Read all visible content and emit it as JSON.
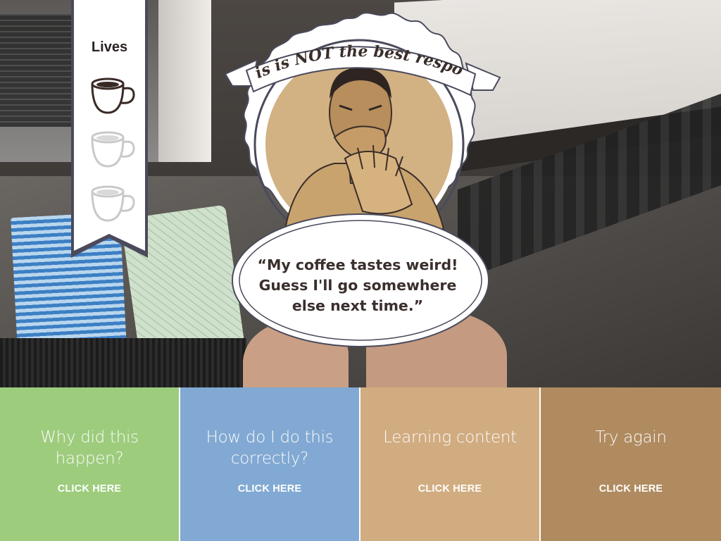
{
  "lives": {
    "title": "Lives",
    "total": 3,
    "remaining": 1,
    "cups": [
      {
        "state": "full",
        "icon": "coffee-cup-full-icon"
      },
      {
        "state": "empty",
        "icon": "coffee-cup-empty-icon"
      },
      {
        "state": "empty",
        "icon": "coffee-cup-empty-icon"
      }
    ]
  },
  "feedback": {
    "ribbon_text": "This is NOT the best response",
    "quote": "“My coffee tastes weird! Guess I'll go somewhere else next time.”",
    "illustration": "disgusted-customer-illustration"
  },
  "actions": [
    {
      "label": "Why did this happen?",
      "cta": "CLICK HERE",
      "color": "#9dcc7d"
    },
    {
      "label": "How do I do this correctly?",
      "cta": "CLICK HERE",
      "color": "#81a9d3"
    },
    {
      "label": "Learning content",
      "cta": "CLICK HERE",
      "color": "#d1ac80"
    },
    {
      "label": "Try again",
      "cta": "CLICK HERE",
      "color": "#b08b60"
    }
  ]
}
